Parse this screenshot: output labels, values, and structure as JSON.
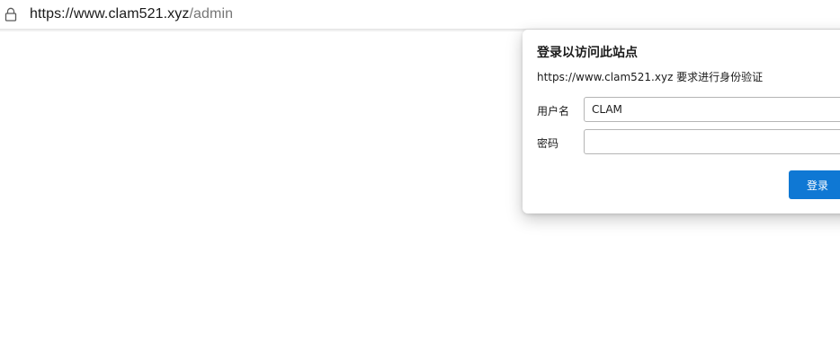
{
  "address_bar": {
    "url_host": "https://www.clam521.xyz",
    "url_path": "/admin",
    "icon": "lock-icon"
  },
  "auth_dialog": {
    "title": "登录以访问此站点",
    "subtitle": "https://www.clam521.xyz 要求进行身份验证",
    "username_label": "用户名",
    "username_value": "CLAM",
    "password_label": "密码",
    "password_value": "",
    "login_button_label": "登录"
  },
  "colors": {
    "accent": "#0f78d4",
    "url_path": "#767676"
  }
}
